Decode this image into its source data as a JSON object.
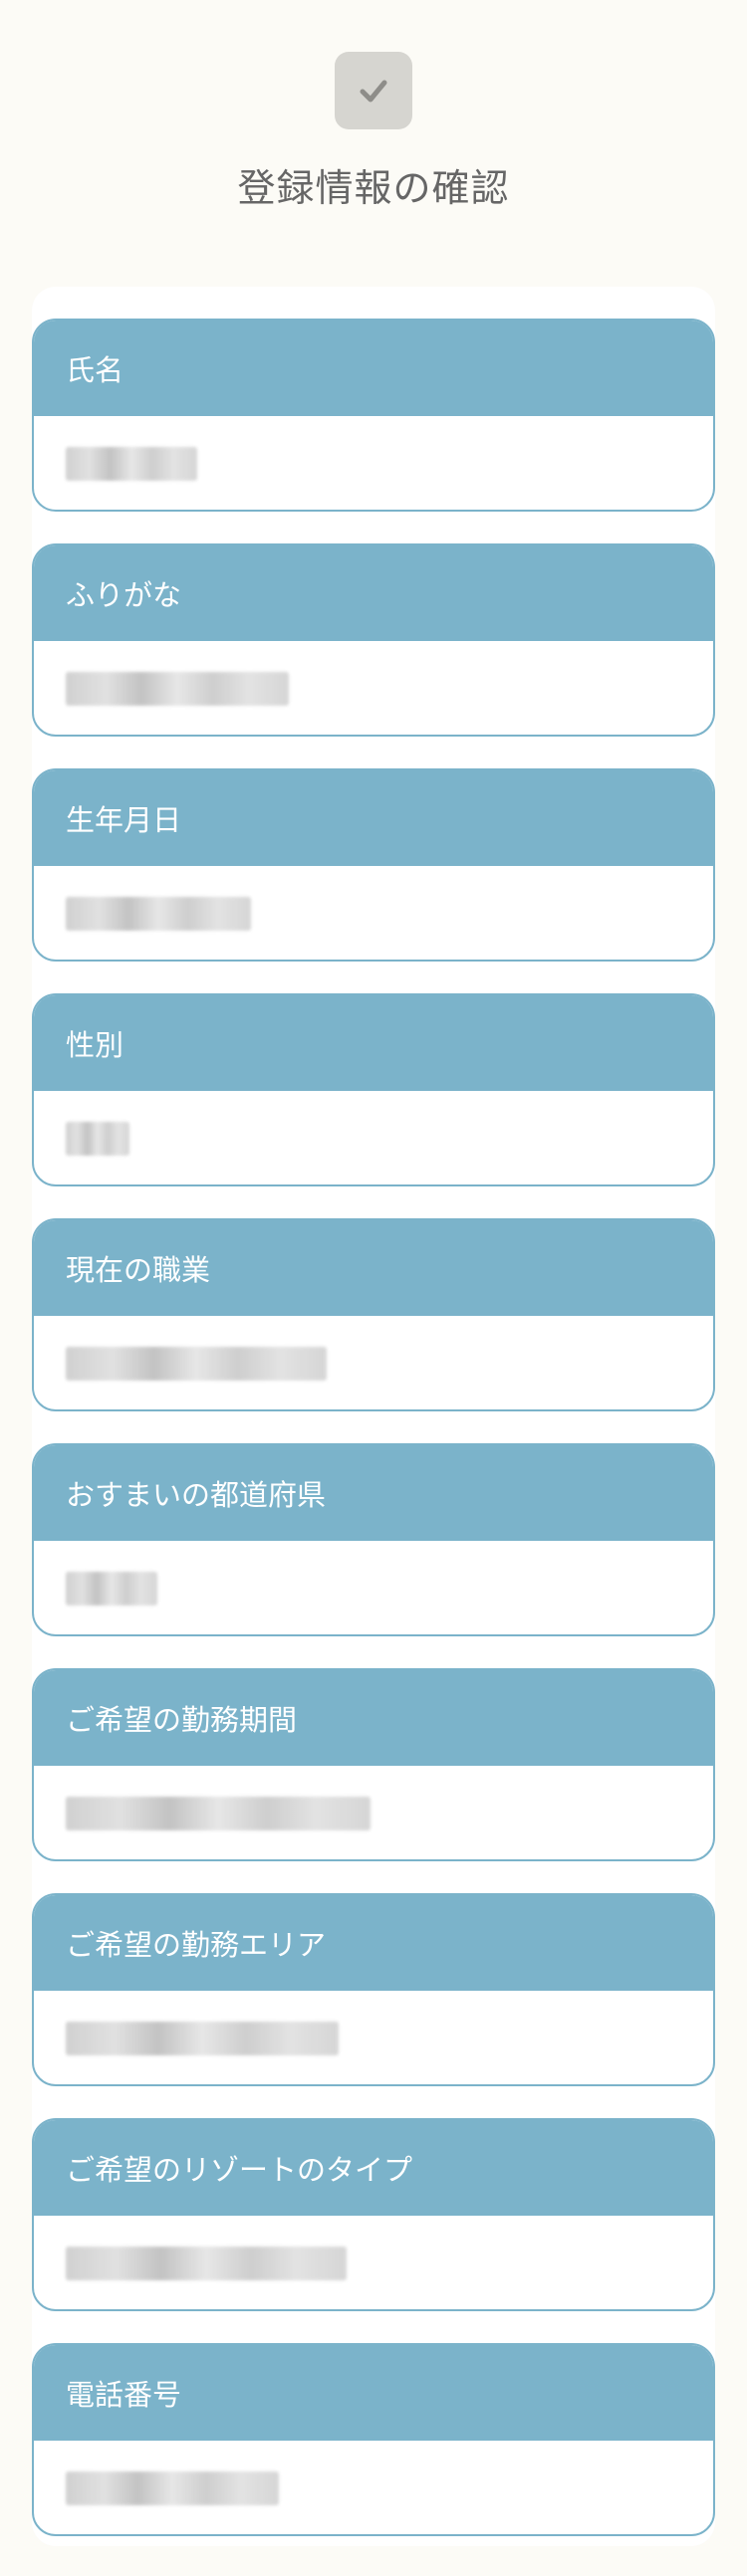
{
  "header": {
    "title": "登録情報の確認",
    "icon": "check-icon",
    "icon_bg": "#d6d5d0",
    "icon_color": "#8e8d89"
  },
  "theme": {
    "accent": "#7bb3ca",
    "background": "#fcfbf6"
  },
  "fields": [
    {
      "label": "氏名",
      "value_redacted": true
    },
    {
      "label": "ふりがな",
      "value_redacted": true
    },
    {
      "label": "生年月日",
      "value_redacted": true
    },
    {
      "label": "性別",
      "value_redacted": true
    },
    {
      "label": "現在の職業",
      "value_redacted": true
    },
    {
      "label": "おすまいの都道府県",
      "value_redacted": true
    },
    {
      "label": "ご希望の勤務期間",
      "value_redacted": true
    },
    {
      "label": "ご希望の勤務エリア",
      "value_redacted": true
    },
    {
      "label": "ご希望のリゾートのタイプ",
      "value_redacted": true
    },
    {
      "label": "電話番号",
      "value_redacted": true
    }
  ]
}
